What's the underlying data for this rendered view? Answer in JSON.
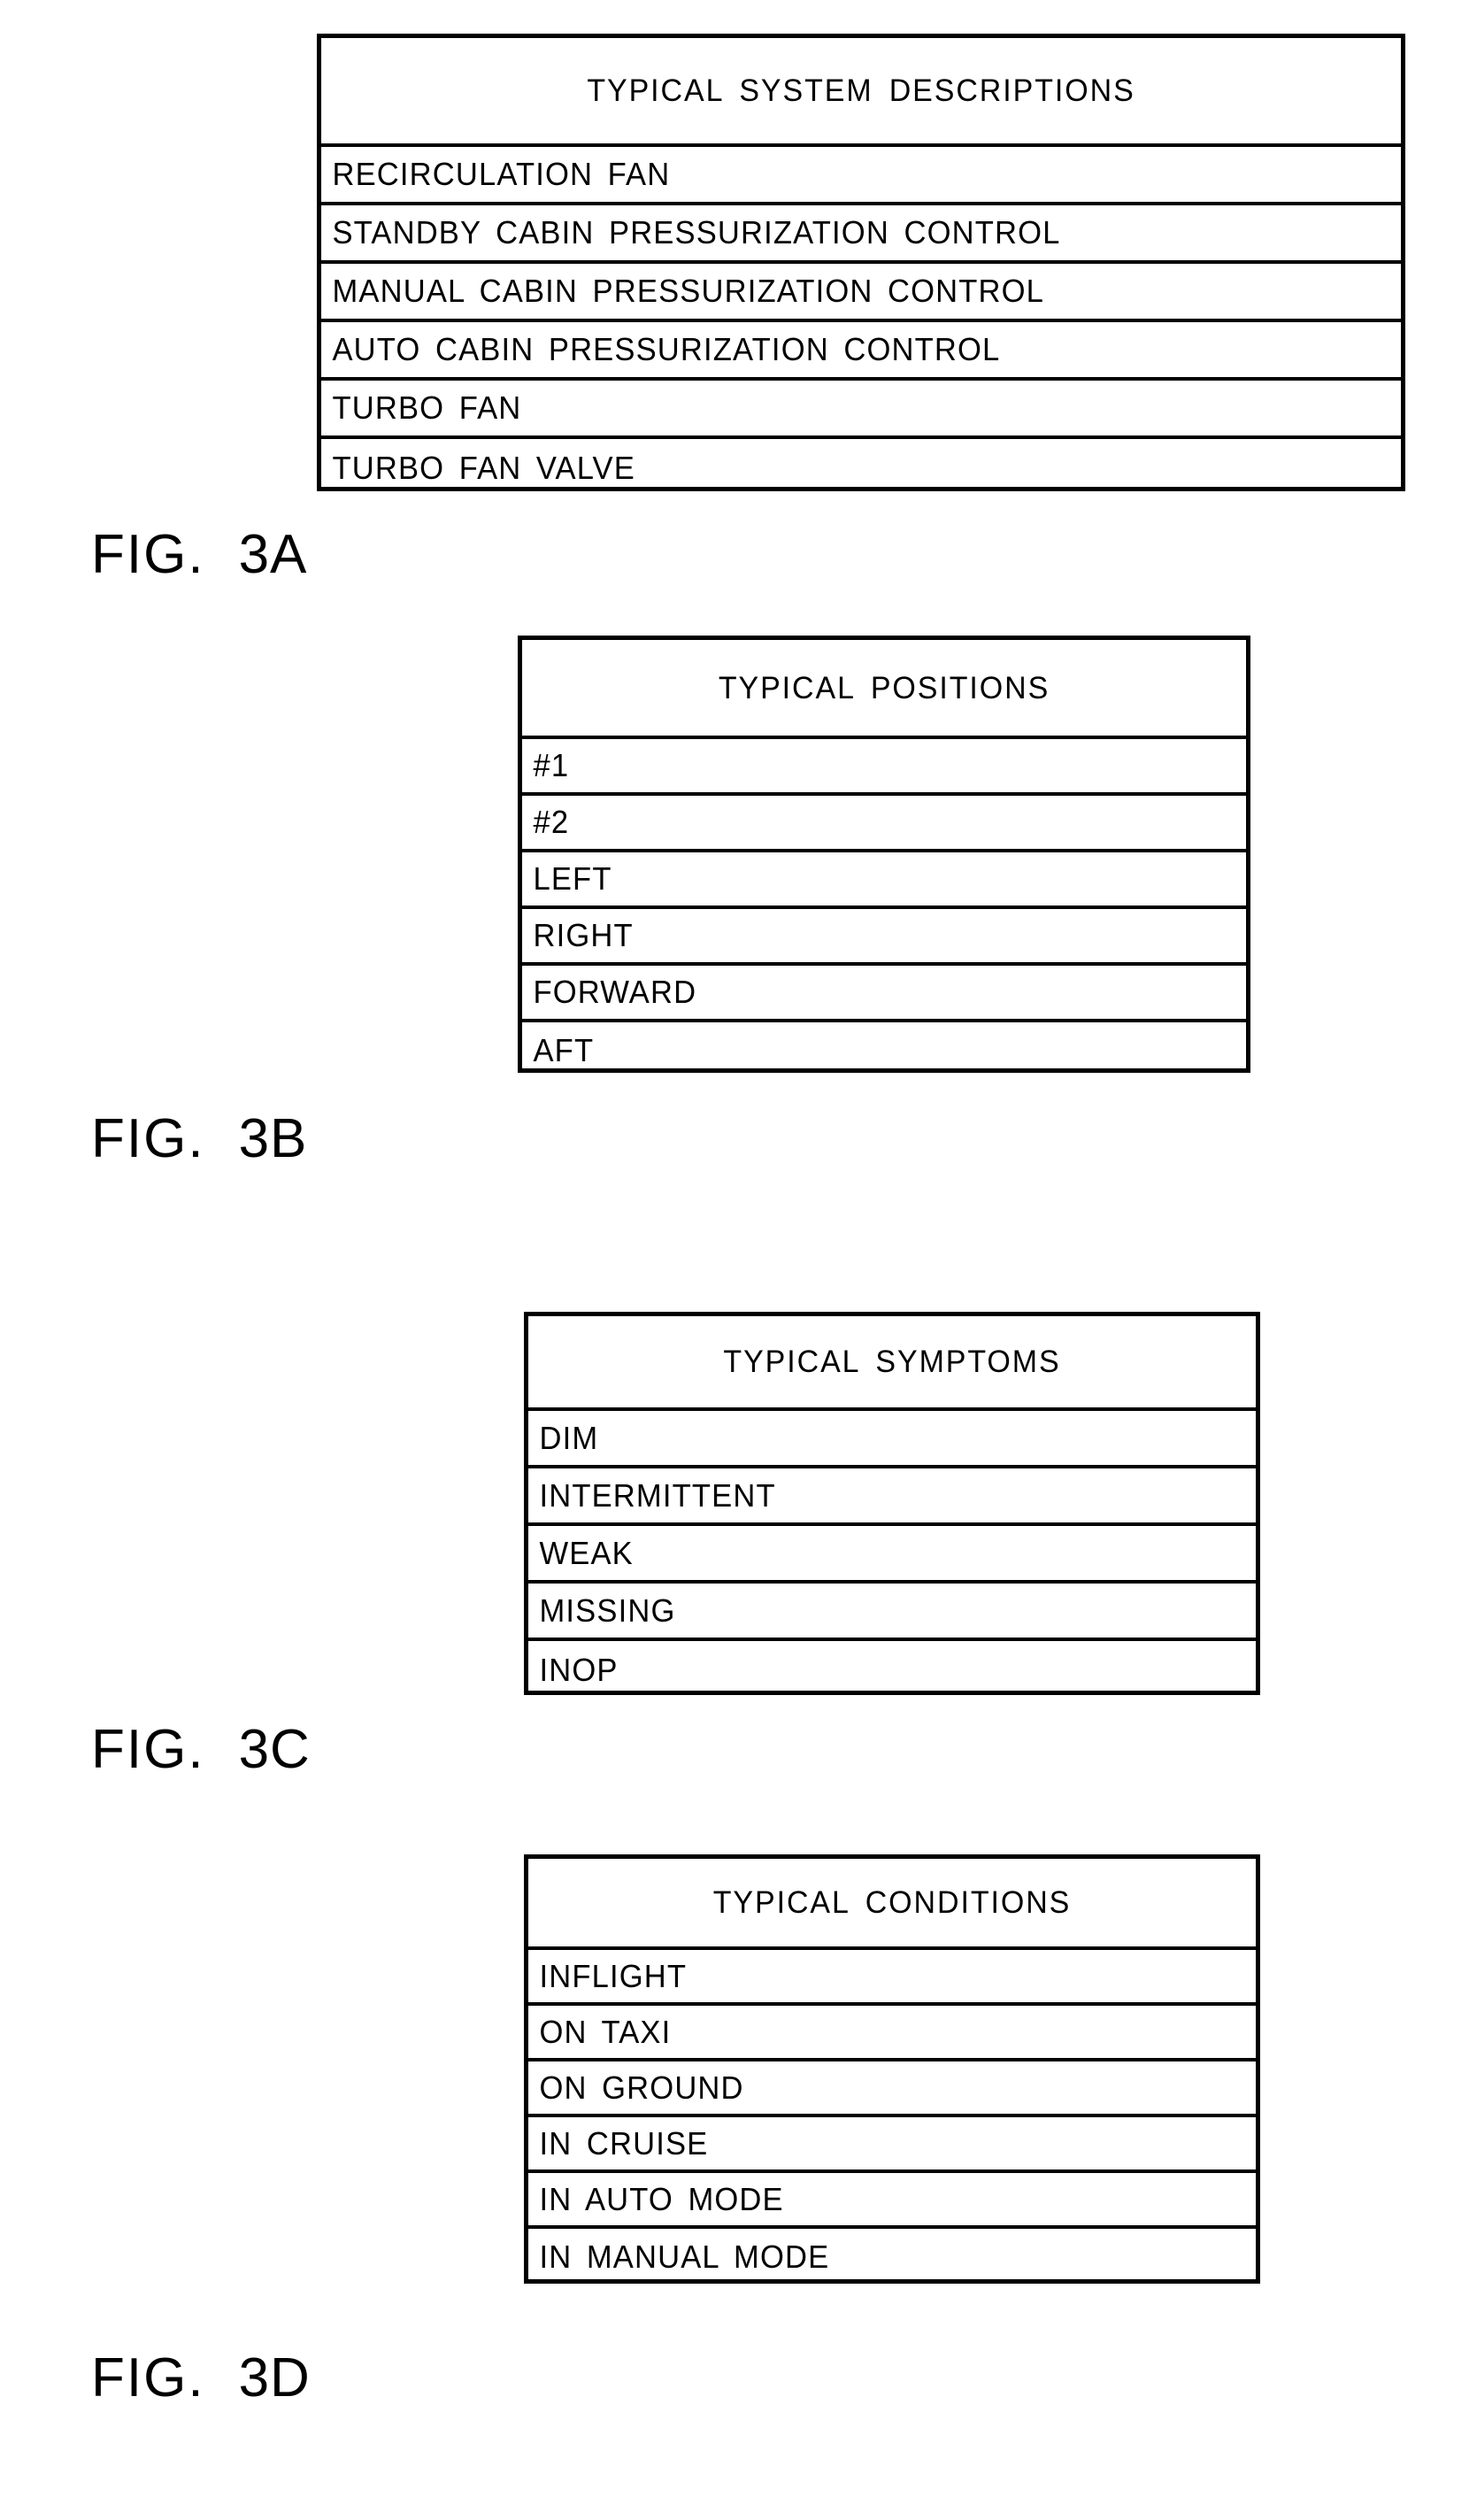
{
  "document": {
    "type": "patent-drawing-sheet",
    "background_color": "#ffffff",
    "line_color": "#000000"
  },
  "figures": [
    {
      "id": "3A",
      "label_prefix": "FIG.",
      "label_number": "3A",
      "table": {
        "header": "TYPICAL SYSTEM DESCRIPTIONS",
        "rows": [
          "RECIRCULATION FAN",
          "STANDBY CABIN PRESSURIZATION CONTROL",
          "MANUAL CABIN PRESSURIZATION CONTROL",
          "AUTO CABIN PRESSURIZATION CONTROL",
          "TURBO FAN",
          "TURBO FAN VALVE"
        ]
      }
    },
    {
      "id": "3B",
      "label_prefix": "FIG.",
      "label_number": "3B",
      "table": {
        "header": "TYPICAL POSITIONS",
        "rows": [
          "#1",
          "#2",
          "LEFT",
          "RIGHT",
          "FORWARD",
          "AFT"
        ]
      }
    },
    {
      "id": "3C",
      "label_prefix": "FIG.",
      "label_number": "3C",
      "table": {
        "header": "TYPICAL SYMPTOMS",
        "rows": [
          "DIM",
          "INTERMITTENT",
          "WEAK",
          "MISSING",
          "INOP"
        ]
      }
    },
    {
      "id": "3D",
      "label_prefix": "FIG.",
      "label_number": "3D",
      "table": {
        "header": "TYPICAL CONDITIONS",
        "rows": [
          "INFLIGHT",
          "ON TAXI",
          "ON GROUND",
          "IN CRUISE",
          "IN AUTO MODE",
          "IN MANUAL MODE"
        ]
      }
    }
  ]
}
